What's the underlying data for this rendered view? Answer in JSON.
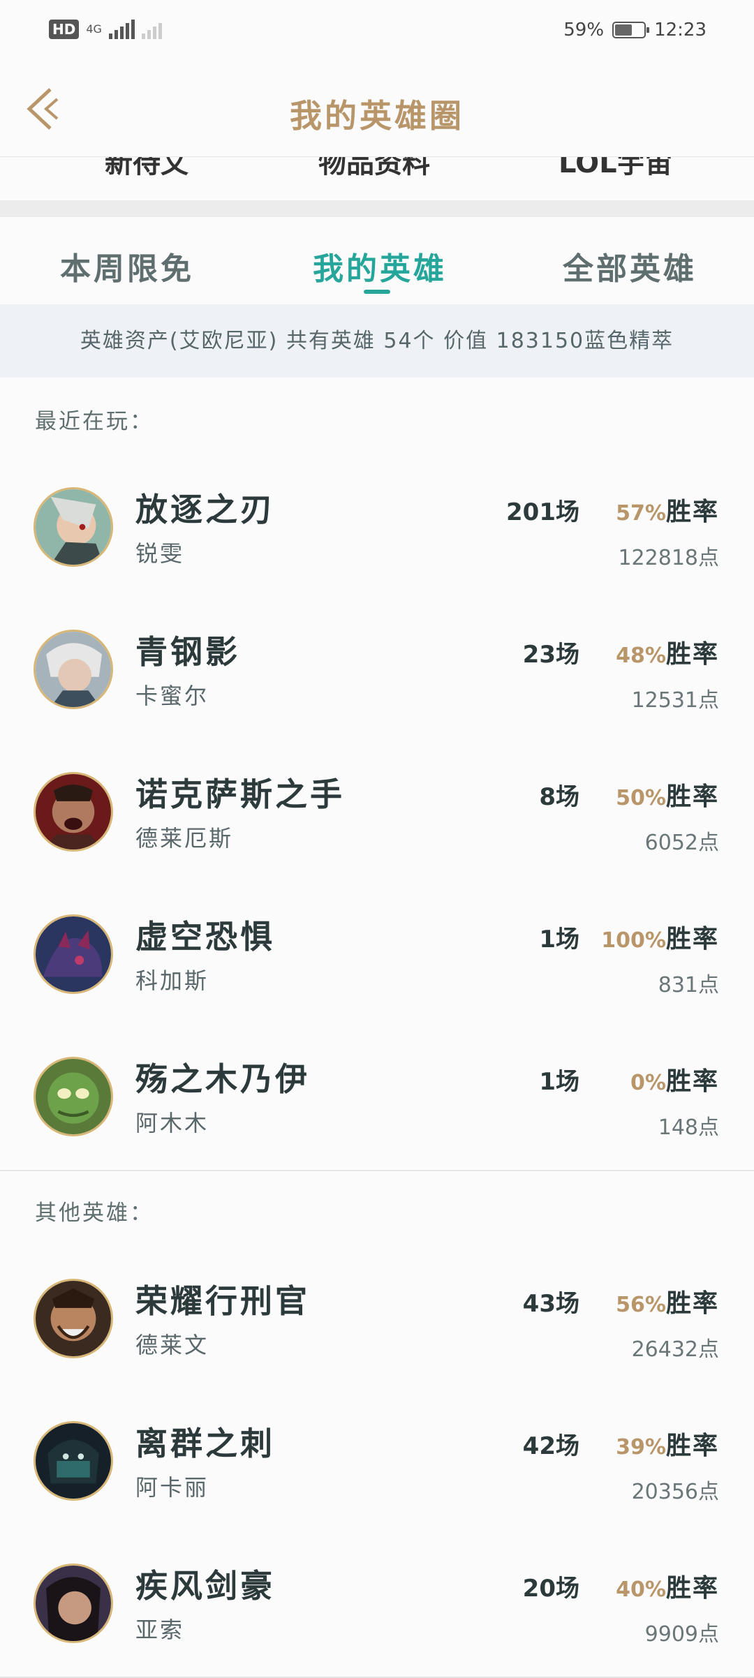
{
  "status": {
    "hd": "HD",
    "network": "4G",
    "battery": "59%",
    "time": "12:23",
    "battery_level": 0.59
  },
  "header": {
    "title": "我的英雄圈"
  },
  "cut_row": [
    "新待文",
    "物品资料",
    "LOL宇宙"
  ],
  "tabs": [
    "本周限免",
    "我的英雄",
    "全部英雄"
  ],
  "assets_text": "英雄资产(艾欧尼亚) 共有英雄 54个 价值 183150蓝色精萃",
  "sections": {
    "recent": "最近在玩：",
    "others": "其他英雄："
  },
  "win_label": "胜率",
  "recent_heroes": [
    {
      "title": "放逐之刃",
      "name": "锐雯",
      "games": "201场",
      "rate": "57%",
      "points": "122818点"
    },
    {
      "title": "青钢影",
      "name": "卡蜜尔",
      "games": "23场",
      "rate": "48%",
      "points": "12531点"
    },
    {
      "title": "诺克萨斯之手",
      "name": "德莱厄斯",
      "games": "8场",
      "rate": "50%",
      "points": "6052点"
    },
    {
      "title": "虚空恐惧",
      "name": "科加斯",
      "games": "1场",
      "rate": "100%",
      "points": "831点"
    },
    {
      "title": "殇之木乃伊",
      "name": "阿木木",
      "games": "1场",
      "rate": "0%",
      "points": "148点"
    }
  ],
  "other_heroes": [
    {
      "title": "荣耀行刑官",
      "name": "德莱文",
      "games": "43场",
      "rate": "56%",
      "points": "26432点"
    },
    {
      "title": "离群之刺",
      "name": "阿卡丽",
      "games": "42场",
      "rate": "39%",
      "points": "20356点"
    },
    {
      "title": "疾风剑豪",
      "name": "亚索",
      "games": "20场",
      "rate": "40%",
      "points": "9909点"
    }
  ],
  "colors": {
    "accent": "#26a69a",
    "gold": "#b8966a"
  }
}
